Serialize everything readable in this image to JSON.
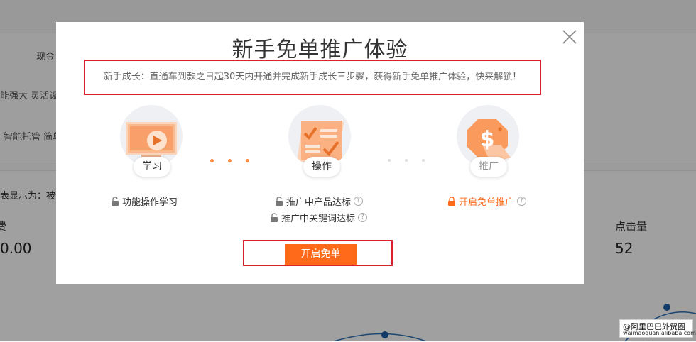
{
  "background": {
    "header_label": "现金",
    "row1_text": "能强大 灵活设",
    "row2_text": "智能托管 简单",
    "notice_text": "表显示为：被这",
    "metric_left_label": "费",
    "metric_left_value": "0.00",
    "metric_right_label": "点击量",
    "metric_right_value": "52"
  },
  "modal": {
    "title": "新手免单推广体验",
    "description": "新手成长：直通车到款之日起30天内开通并完成新手成长三步骤，获得新手免单推广体验，快来解锁！",
    "steps": [
      {
        "label": "学习",
        "icon": "monitor-play-icon"
      },
      {
        "label": "操作",
        "icon": "checklist-icon"
      },
      {
        "label": "推广",
        "icon": "dollar-tag-icon"
      }
    ],
    "tasks": {
      "learn": "功能操作学习",
      "product": "推广中产品达标",
      "keyword": "推广中关键词达标",
      "promote": "开启免单推广"
    },
    "help_glyph": "?",
    "button_label": "开启免单"
  },
  "colors": {
    "accent": "#ff6a1a",
    "highlight_border": "#d9232b",
    "inactive_dot": "#dddddd"
  },
  "watermark": {
    "line1": "@阿里巴巴外贸圈",
    "line2": "waimaoquan.alibaba.com"
  }
}
